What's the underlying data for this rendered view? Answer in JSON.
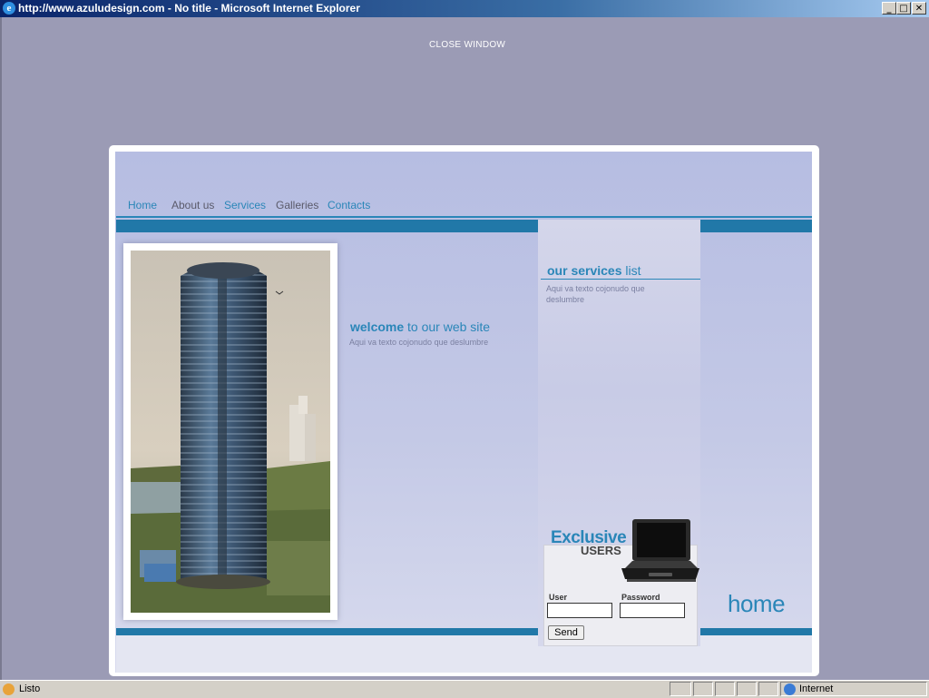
{
  "window": {
    "title": "http://www.azuludesign.com - No title - Microsoft Internet Explorer",
    "minimize": "_",
    "maximize": "□",
    "close": "✕"
  },
  "page": {
    "close_window": "CLOSE WINDOW"
  },
  "nav": {
    "items": [
      {
        "label": "Home"
      },
      {
        "label": "About us"
      },
      {
        "label": "Services"
      },
      {
        "label": "Galleries"
      },
      {
        "label": "Contacts"
      }
    ]
  },
  "welcome": {
    "strong": "welcome",
    "rest": " to our web site",
    "text": "Aqui va texto cojonudo que deslumbre"
  },
  "services": {
    "strong": "our services",
    "rest": " list",
    "text": "Aqui va texto cojonudo que deslumbre"
  },
  "login": {
    "banner_line1": "Exclusive",
    "banner_line2": "USERS",
    "user_label": "User",
    "password_label": "Password",
    "user_value": "",
    "password_value": "",
    "send_label": "Send"
  },
  "section_title": "home",
  "statusbar": {
    "status": "Listo",
    "zone": "Internet"
  },
  "colors": {
    "accent": "#2a86b8",
    "band": "#2178a8",
    "background": "#9b9bb5"
  },
  "icons": [
    "ie-icon",
    "laptop-icon",
    "internet-zone-icon"
  ]
}
